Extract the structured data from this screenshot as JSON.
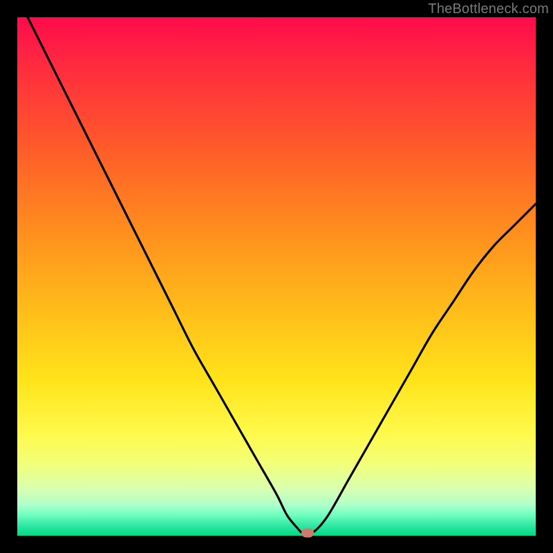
{
  "attribution": "TheBottleneck.com",
  "colors": {
    "frame": "#000000",
    "gradient_top": "#ff0b4b",
    "gradient_bottom": "#00d885",
    "curve": "#000000",
    "marker": "#cc7a6a"
  },
  "chart_data": {
    "type": "line",
    "title": "",
    "xlabel": "",
    "ylabel": "",
    "xlim": [
      0,
      100
    ],
    "ylim": [
      0,
      100
    ],
    "grid": false,
    "legend": false,
    "series": [
      {
        "name": "bottleneck-curve",
        "x": [
          2.0,
          6.0,
          10.0,
          14.0,
          18.0,
          22.0,
          26.0,
          30.0,
          34.0,
          38.0,
          42.0,
          46.0,
          50.0,
          52.0,
          54.0,
          55.0,
          56.0,
          57.5,
          60.0,
          64.0,
          68.0,
          72.0,
          76.0,
          80.0,
          84.0,
          88.0,
          92.0,
          96.0,
          100.0
        ],
        "y": [
          100.0,
          92.0,
          84.0,
          76.0,
          68.0,
          60.0,
          52.0,
          44.0,
          36.0,
          29.0,
          22.0,
          15.0,
          8.0,
          4.0,
          1.5,
          0.5,
          0.5,
          1.0,
          4.0,
          11.0,
          18.0,
          25.0,
          32.0,
          39.0,
          45.0,
          51.0,
          56.0,
          60.0,
          64.0
        ]
      }
    ],
    "markers": [
      {
        "name": "optimal-point",
        "x": 56.0,
        "y": 0.5
      }
    ]
  }
}
